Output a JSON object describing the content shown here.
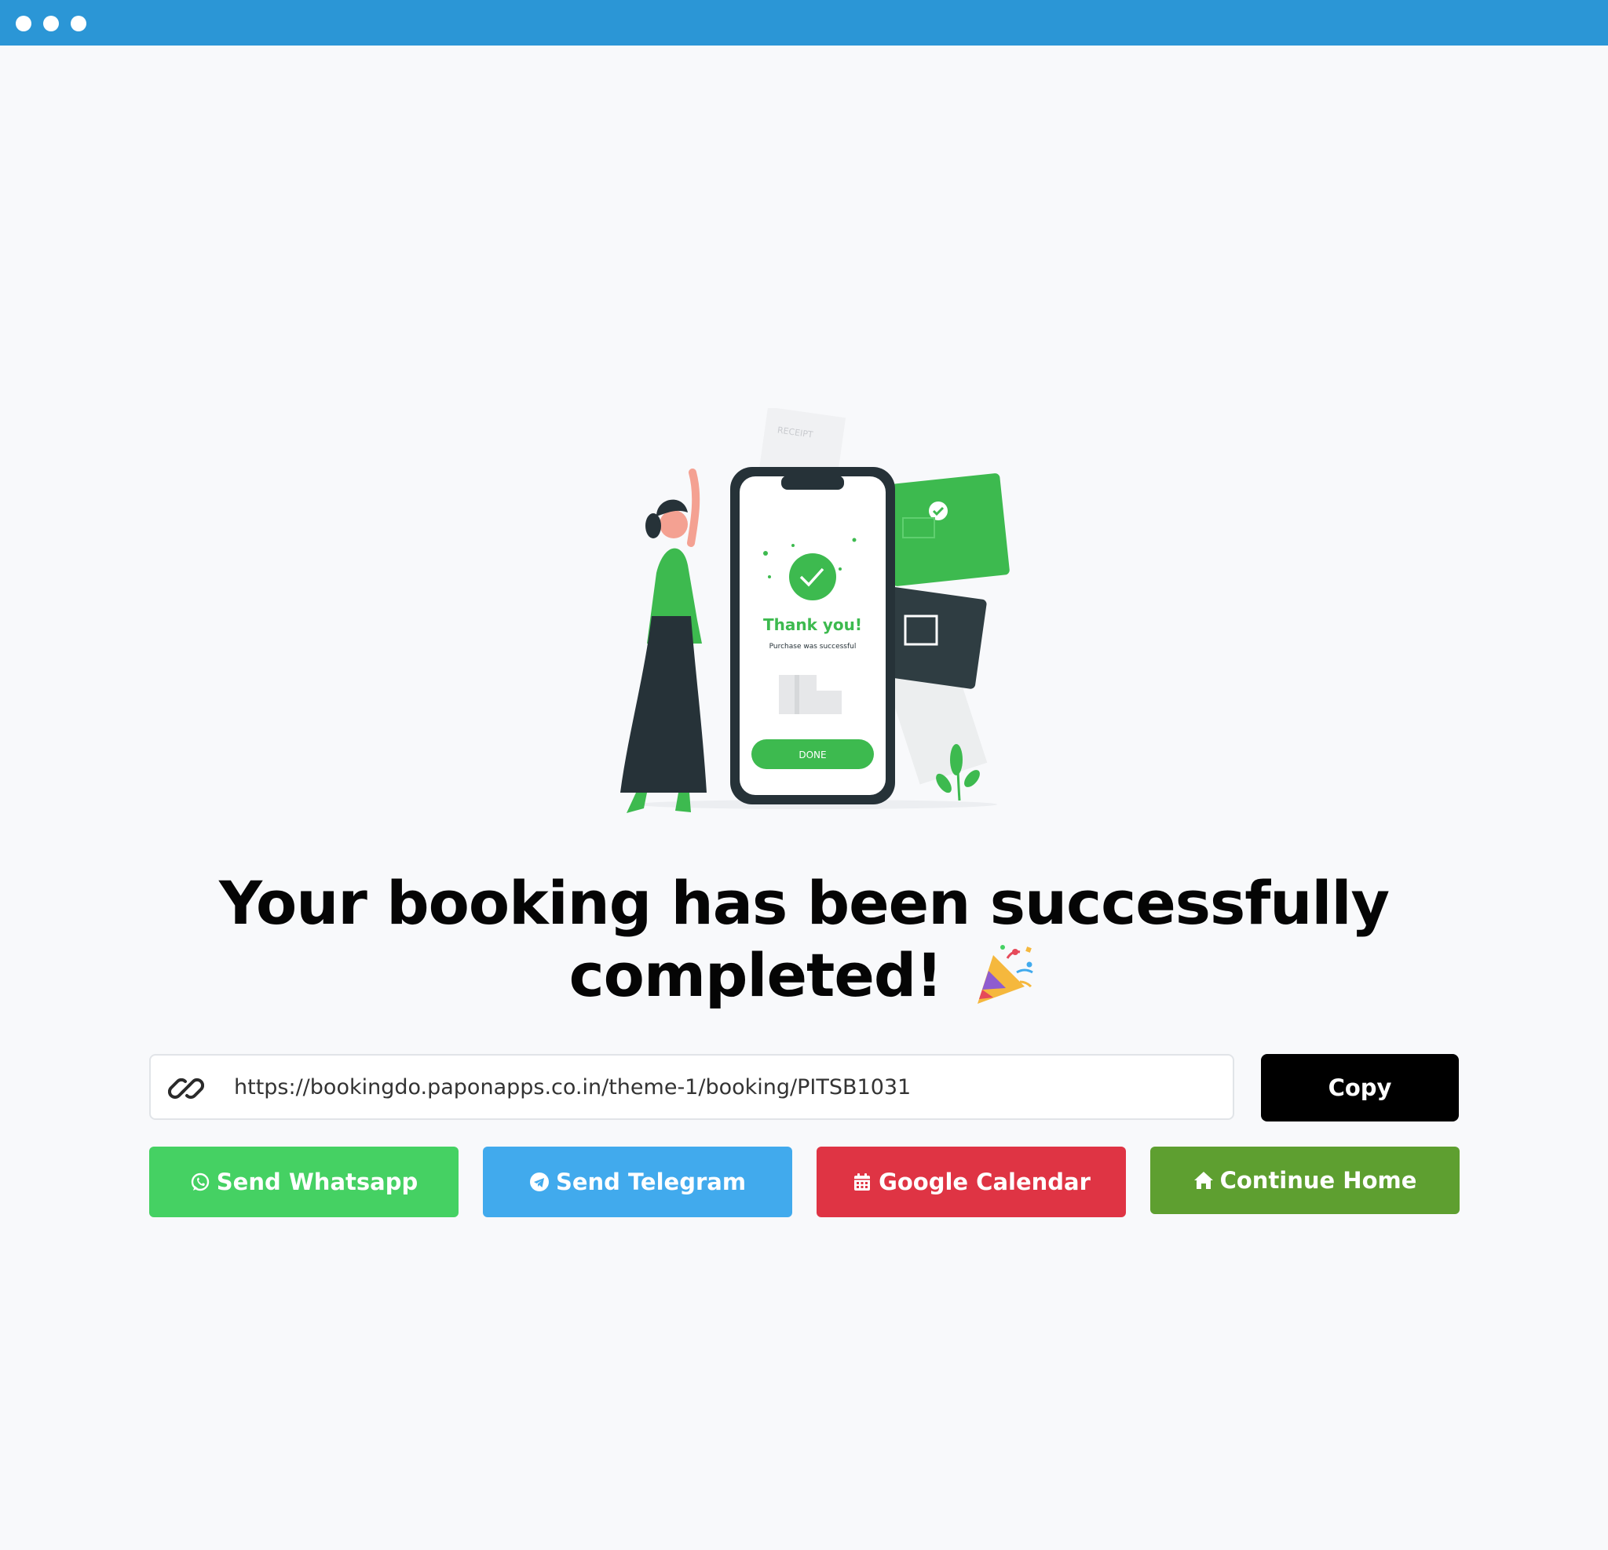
{
  "window": {
    "controls": [
      "window-dot",
      "window-dot",
      "window-dot"
    ]
  },
  "illustration": {
    "phone_title": "Thank you!",
    "phone_subtitle": "Purchase was successful",
    "phone_button": "DONE",
    "receipt_label": "RECEIPT",
    "accent_color": "#3dba4f"
  },
  "headline": {
    "line1": "Your booking has been successfully",
    "line2": "completed!",
    "emoji_icon": "party-popper-icon"
  },
  "share_link": {
    "icon": "link-icon",
    "value": "https://bookingdo.paponapps.co.in/theme-1/booking/PITSB1031"
  },
  "copy_button": {
    "label": "Copy"
  },
  "actions": {
    "whatsapp": {
      "label": "Send Whatsapp",
      "icon": "whatsapp-icon",
      "color": "#45d163"
    },
    "telegram": {
      "label": "Send Telegram",
      "icon": "telegram-icon",
      "color": "#41aaed"
    },
    "calendar": {
      "label": "Google Calendar",
      "icon": "calendar-icon",
      "color": "#df3444"
    },
    "home": {
      "label": "Continue Home",
      "icon": "home-icon",
      "color": "#5e9f30"
    }
  },
  "colors": {
    "titlebar": "#2b96d6",
    "background": "#f8f9fb",
    "copy_button": "#000000"
  }
}
